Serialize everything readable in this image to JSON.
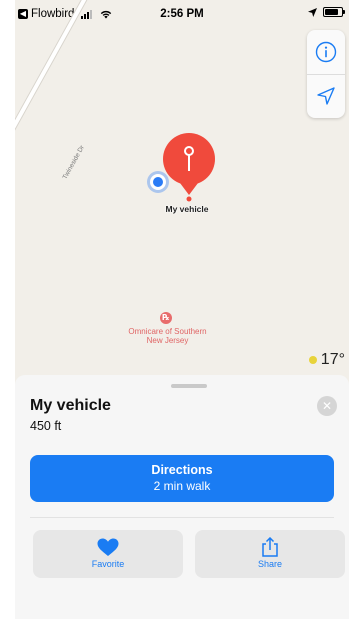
{
  "status_bar": {
    "back_app": "Flowbird",
    "time": "2:56 PM"
  },
  "map": {
    "street_name": "Twineside Dr",
    "pin_label": "My vehicle",
    "poi_name": "Omnicare of Southern New Jersey",
    "temperature": "17°",
    "controls": {
      "info_icon": "info-icon",
      "locate_icon": "location-arrow-icon"
    }
  },
  "sheet": {
    "title": "My vehicle",
    "distance": "450 ft",
    "directions_label": "Directions",
    "directions_sub": "2 min walk",
    "favorite_label": "Favorite",
    "share_label": "Share"
  },
  "colors": {
    "accent": "#1a7cf3",
    "pin": "#f04a3c",
    "poi": "#e06565"
  }
}
